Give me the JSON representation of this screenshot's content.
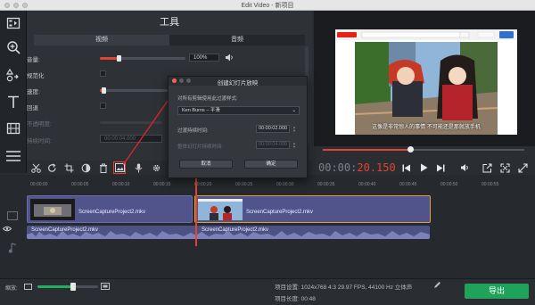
{
  "window": {
    "title": "Edit Video - 新项目"
  },
  "tools_panel": {
    "title": "工具",
    "tabs": [
      {
        "label": "视频"
      },
      {
        "label": "音频"
      }
    ],
    "rows": {
      "volume": {
        "label": "音量:",
        "value": "100%",
        "level": 0.22
      },
      "normalize": {
        "label": "规范化"
      },
      "speed": {
        "label": "速度:",
        "level": 0.05
      },
      "reverse": {
        "label": "回退"
      },
      "opacity": {
        "label": "不透明度:"
      },
      "duration": {
        "label": "持续时间:",
        "value": "00:00:04.000"
      }
    }
  },
  "dialog": {
    "title": "创建幻灯片放映",
    "instruction": "对所有剪辑使用此过渡样式:",
    "transition_select": "Ken Burns – 平滑",
    "transition_duration_label": "过渡持续时间:",
    "transition_duration_value": "00:00:02.000",
    "image_duration_label": "整体幻灯片持续时间:",
    "image_duration_value": "00:00:04.000",
    "cancel_label": "取消",
    "ok_label": "确定"
  },
  "preview": {
    "subtitle": "这像是非常惊人的事情 不可能还是那就放手机",
    "playback_progress": 0.43,
    "timecode_dim": "00:00:",
    "timecode_hl": "20.150"
  },
  "timeline": {
    "ruler": [
      "00:00:00",
      "00:00:05",
      "00:00:10",
      "00:00:15",
      "00:00:20",
      "00:00:25",
      "00:00:30",
      "00:00:35",
      "00:00:40",
      "00:00:45",
      "00:00:50",
      "00:00:55"
    ],
    "clips": [
      {
        "name": "ScreenCaptureProject2.mkv"
      },
      {
        "name": "ScreenCaptureProject2.mkv"
      }
    ],
    "audio": [
      {
        "name": "ScreenCaptureProject2.mkv"
      },
      {
        "name": "ScreenCaptureProject2.mkv"
      }
    ]
  },
  "bottom": {
    "scale_label": "缩放:",
    "zoom_level": 0.6,
    "project_settings_label": "项目设置:",
    "project_settings_value": "1024x768 4:3 29.97 FPS, 44100 Hz 立体声",
    "project_length_label": "项目长度:",
    "project_length_value": "00:48",
    "export_label": "导出"
  },
  "colors": {
    "accent": "#e0452e",
    "export": "#1fa35a",
    "clip": "#51548a"
  }
}
